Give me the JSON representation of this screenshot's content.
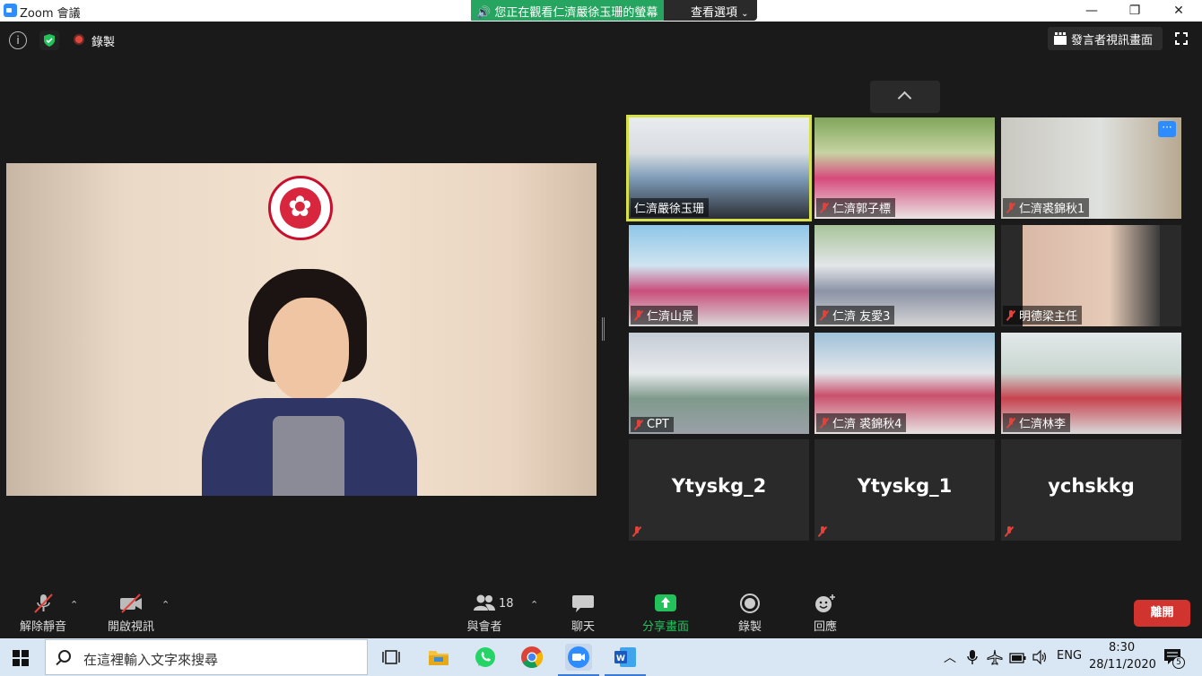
{
  "window": {
    "title": "Zoom 會議",
    "share_banner": "您正在觀看仁濟嚴徐玉珊的螢幕",
    "view_options": "查看選項"
  },
  "topbar": {
    "recording_label": "錄製",
    "speaker_view_label": "發言者視訊畫面"
  },
  "participants_grid": [
    {
      "name": "仁濟嚴徐玉珊",
      "muted": false,
      "active_speaker": true
    },
    {
      "name": "仁濟郭子標",
      "muted": true
    },
    {
      "name": "仁濟裘錦秋1",
      "muted": true,
      "has_more_button": true
    },
    {
      "name": "仁濟山景",
      "muted": true
    },
    {
      "name": "仁濟 友愛3",
      "muted": true
    },
    {
      "name": "明德梁主任",
      "muted": true
    },
    {
      "name": "CPT",
      "muted": true
    },
    {
      "name": "仁濟 裘錦秋4",
      "muted": true
    },
    {
      "name": "仁濟林李",
      "muted": true
    },
    {
      "name": "Ytyskg_2",
      "muted": true,
      "video_off": true
    },
    {
      "name": "Ytyskg_1",
      "muted": true,
      "video_off": true
    },
    {
      "name": "ychskkg",
      "muted": true,
      "video_off": true
    }
  ],
  "more_button_label": "···",
  "toolbar": {
    "unmute_label": "解除靜音",
    "start_video_label": "開啟視訊",
    "participants_label": "與會者",
    "participants_count": "18",
    "chat_label": "聊天",
    "share_screen_label": "分享畫面",
    "record_label": "錄製",
    "reactions_label": "回應",
    "leave_label": "離開"
  },
  "taskbar": {
    "search_placeholder": "在這裡輸入文字來搜尋",
    "language": "ENG",
    "time": "8:30",
    "date": "28/11/2020",
    "notifications_count": "5"
  },
  "colors": {
    "share_banner": "#25a55f",
    "active_speaker_border": "#d6e04a",
    "leave_button": "#d1342f",
    "share_screen_icon": "#23c15c",
    "muted_red": "#e3423b"
  }
}
